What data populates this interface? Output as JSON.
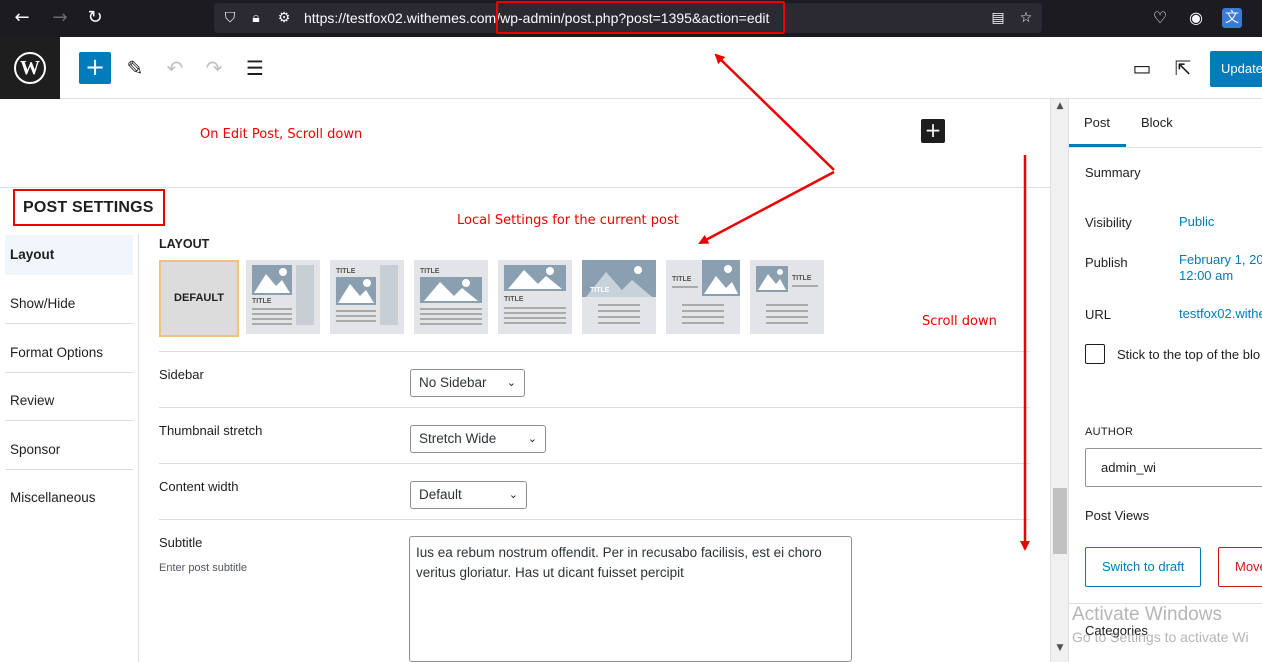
{
  "browser": {
    "url_host": "https://testfox02.withemes.com",
    "url_path": "/wp-admin/post.php?post=1395&action=edit"
  },
  "toolbar": {
    "update_label": "Update"
  },
  "editor": {
    "annotation_scroll": "On Edit Post, Scroll down",
    "annotation_local": "Local Settings for the current post",
    "annotation_scroll2": "Scroll down"
  },
  "post_settings": {
    "title": "POST SETTINGS",
    "tabs": [
      {
        "label": "Layout",
        "active": true
      },
      {
        "label": "Show/Hide"
      },
      {
        "label": "Format Options"
      },
      {
        "label": "Review"
      },
      {
        "label": "Sponsor"
      },
      {
        "label": "Miscellaneous"
      }
    ],
    "layout_label": "LAYOUT",
    "layout_default_label": "DEFAULT",
    "layout_thumb_title": "TITLE",
    "fields": {
      "sidebar_label": "Sidebar",
      "sidebar_value": "No Sidebar",
      "thumbnail_label": "Thumbnail stretch",
      "thumbnail_value": "Stretch Wide",
      "content_width_label": "Content width",
      "content_width_value": "Default",
      "subtitle_label": "Subtitle",
      "subtitle_hint": "Enter post subtitle",
      "subtitle_value": "Ius ea rebum nostrum offendit. Per in recusabo facilisis, est ei choro veritus gloriatur. Has ut dicant fuisset percipit"
    }
  },
  "sidebar": {
    "tab_post": "Post",
    "tab_block": "Block",
    "summary": "Summary",
    "visibility_label": "Visibility",
    "visibility_value": "Public",
    "publish_label": "Publish",
    "publish_value_1": "February 1, 20",
    "publish_value_2": "12:00 am",
    "url_label": "URL",
    "url_value": "testfox02.withe",
    "stick_label": "Stick to the top of the blo",
    "author_label": "AUTHOR",
    "author_value": "admin_wi",
    "post_views": "Post Views",
    "switch_draft": "Switch to draft",
    "move_trash": "Move",
    "categories": "Categories"
  },
  "watermark": {
    "line1": "Activate Windows",
    "line2": "Go to Settings to activate Wi"
  },
  "colors": {
    "accent": "#007cba",
    "annotation": "#e00000",
    "browser_bg": "#1c1b22"
  }
}
